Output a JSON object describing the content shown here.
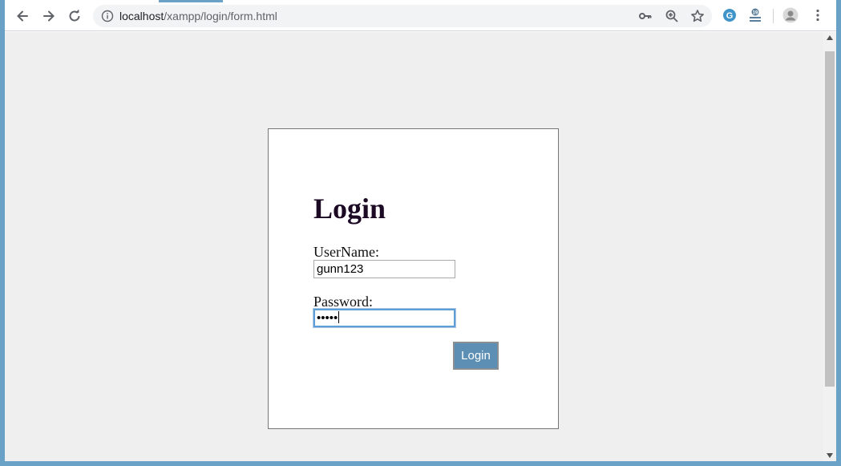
{
  "browser": {
    "url_host": "localhost",
    "url_path": "/xampp/login/form.html"
  },
  "icons": {
    "back": "arrow-left-icon",
    "forward": "arrow-right-icon",
    "reload": "reload-icon",
    "info": "info-icon",
    "key": "key-icon",
    "zoom": "zoom-icon",
    "bookmark": "star-icon",
    "extension1": "grammarly-icon",
    "extension2": "extension-icon",
    "profile": "avatar-icon",
    "menu": "kebab-menu-icon"
  },
  "colors": {
    "desktop_bg": "#6aa2c7",
    "page_bg": "#efefef",
    "button_bg": "#5d8fb4",
    "title_color": "#1c0a24"
  },
  "form": {
    "title": "Login",
    "username_label": "UserName:",
    "username_value": "gunn123",
    "password_label": "Password:",
    "password_masked": "•••••",
    "submit_label": "Login"
  }
}
